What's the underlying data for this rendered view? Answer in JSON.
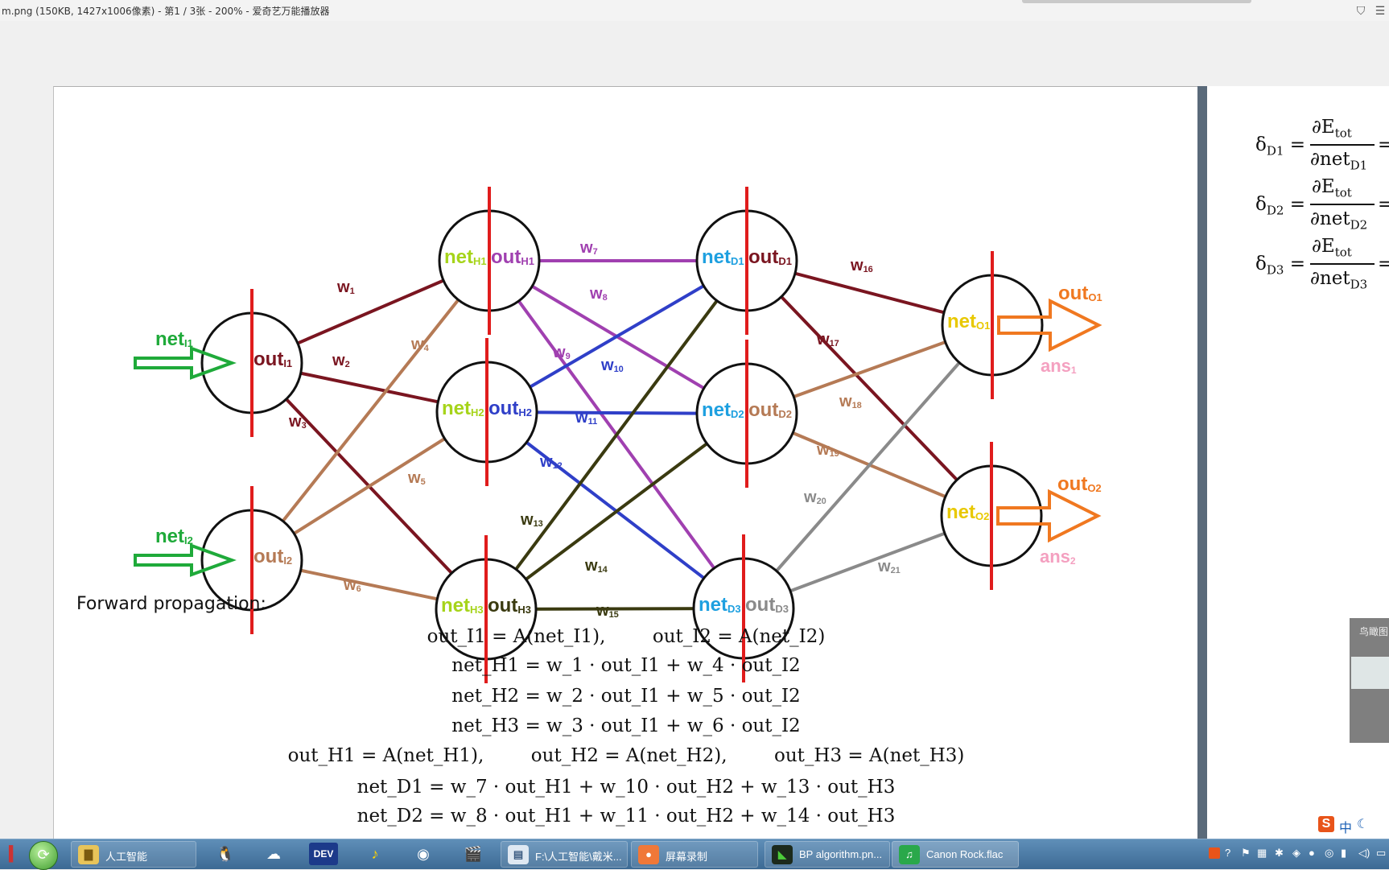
{
  "window": {
    "title": "m.png (150KB, 1427x1006像素) - 第1 / 3张 - 200% - 爱奇艺万能播放器"
  },
  "diagram": {
    "input_nodes": [
      {
        "net": "net",
        "net_sub": "I1",
        "out": "out",
        "out_sub": "I1"
      },
      {
        "net": "net",
        "net_sub": "I2",
        "out": "out",
        "out_sub": "I2"
      }
    ],
    "hidden_nodes": [
      {
        "net": "net",
        "net_sub": "H1",
        "out": "out",
        "out_sub": "H1"
      },
      {
        "net": "net",
        "net_sub": "H2",
        "out": "out",
        "out_sub": "H2"
      },
      {
        "net": "net",
        "net_sub": "H3",
        "out": "out",
        "out_sub": "H3"
      }
    ],
    "d_nodes": [
      {
        "net": "net",
        "net_sub": "D1",
        "out": "out",
        "out_sub": "D1"
      },
      {
        "net": "net",
        "net_sub": "D2",
        "out": "out",
        "out_sub": "D2"
      },
      {
        "net": "net",
        "net_sub": "D3",
        "out": "out",
        "out_sub": "D3"
      }
    ],
    "output_nodes": [
      {
        "net": "net",
        "net_sub": "O1",
        "out": "out",
        "out_sub": "O1",
        "ans": "ans",
        "ans_sub": "1"
      },
      {
        "net": "net",
        "net_sub": "O2",
        "out": "out",
        "out_sub": "O2",
        "ans": "ans",
        "ans_sub": "2"
      }
    ],
    "weights": [
      "w",
      "w",
      "w",
      "w",
      "w",
      "w",
      "w",
      "w",
      "w",
      "w",
      "w",
      "w",
      "w",
      "w",
      "w",
      "w",
      "w",
      "w",
      "w",
      "w",
      "w"
    ],
    "weight_subs": [
      "1",
      "2",
      "3",
      "4",
      "5",
      "6",
      "7",
      "8",
      "9",
      "10",
      "11",
      "12",
      "13",
      "14",
      "15",
      "16",
      "17",
      "18",
      "19",
      "20",
      "21"
    ],
    "colors": {
      "w_in": "#7a1520",
      "w_in2": "#b57a55",
      "h1": "#a040b0",
      "h2": "#2f3fc8",
      "h3": "#3a3a10",
      "d1": "#7a1520",
      "d2": "#b57a55",
      "d3": "#8a8a8a",
      "input_arrow": "#1faa3a",
      "output_arrow": "#f07820",
      "net_green": "#a6d41a",
      "net_blue": "#1ea0e0",
      "net_yellow": "#e8c800",
      "ans_pink": "#f4a0c0",
      "divider": "#e01c1c"
    }
  },
  "forward": {
    "title": "Forward propagation:",
    "lines": [
      "out_I1 = A(net_I1),        out_I2 = A(net_I2)",
      "net_H1 = w_1 · out_I1 + w_4 · out_I2",
      "net_H2 = w_2 · out_I1 + w_5 · out_I2",
      "net_H3 = w_3 · out_I1 + w_6 · out_I2",
      "out_H1 = A(net_H1),        out_H2 = A(net_H2),        out_H3 = A(net_H3)",
      "net_D1 = w_7 · out_H1 + w_10 · out_H2 + w_13 · out_H3",
      "net_D2 = w_8 · out_H1 + w_11 · out_H2 + w_14 · out_H3"
    ]
  },
  "right_page": {
    "deltas": [
      {
        "lhs": "δ",
        "lhs_sub": "D1",
        "num": "∂E",
        "num_sub": "tot",
        "den": "∂net",
        "den_sub": "D1"
      },
      {
        "lhs": "δ",
        "lhs_sub": "D2",
        "num": "∂E",
        "num_sub": "tot",
        "den": "∂net",
        "den_sub": "D2"
      },
      {
        "lhs": "δ",
        "lhs_sub": "D3",
        "num": "∂E",
        "num_sub": "tot",
        "den": "∂net",
        "den_sub": "D3"
      }
    ]
  },
  "birdseye": {
    "title": "鸟瞰图"
  },
  "ime": {
    "label": "中"
  },
  "taskbar": {
    "items": [
      {
        "label": "人工智能",
        "icon": "folder-icon"
      },
      {
        "label": "F:\\人工智能\\戴米...",
        "icon": "window-icon"
      },
      {
        "label": "屏幕录制",
        "icon": "record-icon"
      },
      {
        "label": "BP algorithm.pn...",
        "icon": "image-viewer-icon"
      },
      {
        "label": "Canon Rock.flac",
        "icon": "music-icon"
      }
    ]
  }
}
